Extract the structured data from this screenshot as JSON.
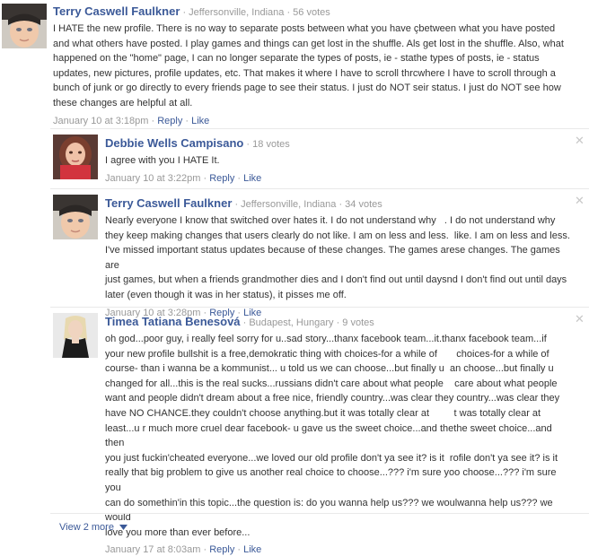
{
  "comments": [
    {
      "author": "Terry Caswell Faulkner",
      "location": "Jeffersonville, Indiana",
      "votes": "56 votes",
      "lines": [
        "I HATE the new profile. There is no way to separate posts between what you have çbetween what you have posted",
        "and what others have posted. I play games and things can get lost in the shuffle. Als get lost in the shuffle. Also, what",
        "happened on the \"home\" page, I can no longer separate the types of posts, ie - stathe types of posts, ie - status",
        "updates, new pictures, profile updates, etc. That makes it where I have to scroll thrcwhere I have to scroll through a",
        "bunch of junk or go directly to every friends page to see their status. I just do NOT seir status. I just do NOT see how",
        "these changes are helpful at all."
      ],
      "time": "January 10 at 3:18pm",
      "reply": "Reply",
      "like": "Like"
    },
    {
      "author": "Debbie Wells Campisano",
      "location": "",
      "votes": "18 votes",
      "lines": [
        "I agree with you I HATE It."
      ],
      "time": "January 10 at 3:22pm",
      "reply": "Reply",
      "like": "Like"
    },
    {
      "author": "Terry Caswell Faulkner",
      "location": "Jeffersonville, Indiana",
      "votes": "34 votes",
      "lines": [
        "Nearly everyone I know that switched over hates it. I do not understand why   . I do not understand why",
        "they keep making changes that users clearly do not like. I am on less and less.  like. I am on less and less.",
        "I've missed important status updates because of these changes. The games arese changes. The games are",
        "just games, but when a friends grandmother dies and I don't find out until daysnd I don't find out until days",
        "later (even though it was in her status), it pisses me off."
      ],
      "time": "January 10 at 3:28pm",
      "reply": "Reply",
      "like": "Like"
    },
    {
      "author": "Timea Tatiana Benesová",
      "location": "Budapest, Hungary",
      "votes": "9 votes",
      "lines": [
        "oh god...poor guy, i really feel sorry for u..sad story...thanx facebook team...it.thanx facebook team...if",
        "your new profile bullshit is a free,demokratic thing with choices-for a while of       choices-for a while of",
        "course- than i wanna be a kommunist... u told us we can choose...but finally u  an choose...but finally u",
        "changed for all...this is the real sucks...russians didn't care about what people    care about what people",
        "want and people didn't dream about a free nice, friendly country...was clear they country...was clear they",
        "have NO CHANCE.they couldn't choose anything.but it was totally clear at         t was totally clear at",
        "least...u r much more cruel dear facebook- u gave us the sweet choice...and thethe sweet choice...and then",
        "you just fuckin'cheated everyone...we loved our old profile don't ya see it? is it  rofile don't ya see it? is it",
        "really that big problem to give us another real choice to choose...??? i'm sure yoo choose...??? i'm sure you",
        "can do somethin'in this topic...the question is: do you wanna help us??? we woulwanna help us??? we would",
        "love you more than ever before..."
      ],
      "time": "January 17 at 8:03am",
      "reply": "Reply",
      "like": "Like"
    }
  ],
  "separator": "·",
  "view_more": "View 2 more",
  "colors": {
    "link": "#3b5998",
    "meta": "#999999",
    "text": "#333333",
    "separator": "#e9e9e9"
  }
}
